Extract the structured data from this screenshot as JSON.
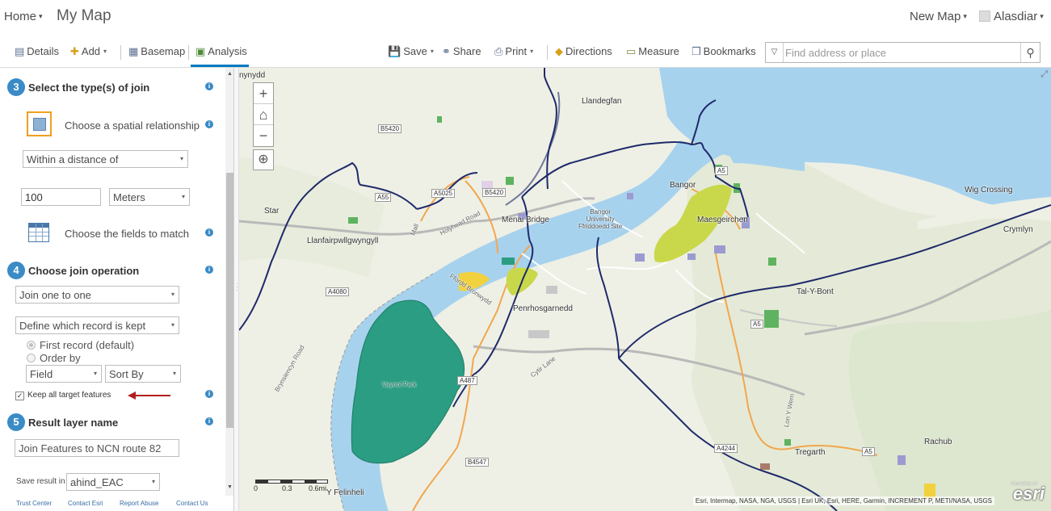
{
  "header": {
    "home_label": "Home",
    "home_caret": "▾",
    "map_title": "My Map",
    "new_map_label": "New Map",
    "new_map_caret": "▾",
    "user_name": "Alasdiar",
    "user_caret": "▾"
  },
  "toolbar": {
    "details": "Details",
    "add": "Add",
    "basemap": "Basemap",
    "analysis": "Analysis",
    "save": "Save",
    "share": "Share",
    "print": "Print",
    "directions": "Directions",
    "measure": "Measure",
    "bookmarks": "Bookmarks",
    "search_placeholder": "Find address or place",
    "caret": "▾",
    "accent_color": "#0079c1"
  },
  "panel": {
    "step3": {
      "number": "3",
      "title": "Select the type(s) of join"
    },
    "spatial_label": "Choose a spatial relationship",
    "relationship_value": "Within a distance of",
    "distance_value": "100",
    "units_value": "Meters",
    "fields_label": "Choose the fields to match",
    "step4": {
      "number": "4",
      "title": "Choose join operation"
    },
    "join_op_value": "Join one to one",
    "record_kept_value": "Define which record is kept",
    "radio_first": "First record (default)",
    "radio_order": "Order by",
    "field_value": "Field",
    "sort_value": "Sort By",
    "keep_all_label": "Keep all target features",
    "keep_all_checked": true,
    "step5": {
      "number": "5",
      "title": "Result layer name"
    },
    "result_name_value": "Join Features to NCN route 82",
    "save_in_label": "Save result in",
    "save_in_value": "ahind_EAC",
    "info_glyph": "i",
    "dd_glyph": "▾",
    "step_color": "#3a8bc6",
    "footer": [
      "Trust Center",
      "Contact Esri",
      "Report Abuse",
      "Contact Us"
    ]
  },
  "map": {
    "zoom_in": "+",
    "zoom_out": "−",
    "home_glyph": "⌂",
    "locate_glyph": "⊕",
    "places": {
      "llandegfan": "Llandegfan",
      "bangor": "Bangor",
      "maesgeirchen": "Maesgeirchen",
      "wig_crossing": "Wig Crossing",
      "menai_bridge": "Menai Bridge",
      "bangor_uni": "Bangor\nUniversity\nFfriddoedd Site",
      "llanfair": "Llanfairpwllgwyngyll",
      "star": "Star",
      "penrhosgarnedd": "Penrhosgarnedd",
      "tal_y_bont": "Tal-Y-Bont",
      "vaynol_park": "Vaynol Park",
      "tregarth": "Tregarth",
      "rachub": "Rachub",
      "y_felinheli": "Y Felinheli",
      "gaerwen": "nynydd",
      "crymlyn": "Crymlyn"
    },
    "roads": {
      "b5420": "B5420",
      "b5420b": "B5420",
      "a55": "A55",
      "a5025": "A5025",
      "a5": "A5",
      "a5b": "A5",
      "a5c": "A5",
      "a4080": "A4080",
      "a487": "A487",
      "a4244": "A4244",
      "b4547": "B4547",
      "holyhead_road": "Holyhead Road",
      "ffordd_bronwydd": "Ffordd Bronwydd",
      "brynsiencyn_road": "Brynsiencyn Road",
      "cytir_lane": "Cytir Lane",
      "lon_y_wern": "Lon Y Wern",
      "mall": "Mall"
    },
    "scale": [
      "0",
      "0.3",
      "0.6mi"
    ],
    "attribution": "Esri, Intermap, NASA, NGA, USGS | Esri UK, Esri, HERE, Garmin, INCREMENT P, METI/NASA, USGS",
    "esri_powered": "POWERED BY",
    "esri_logo": "esri",
    "route_color": "#1f2a6b",
    "water_color": "#a7d2ee",
    "park_color": "#2a9d82"
  }
}
